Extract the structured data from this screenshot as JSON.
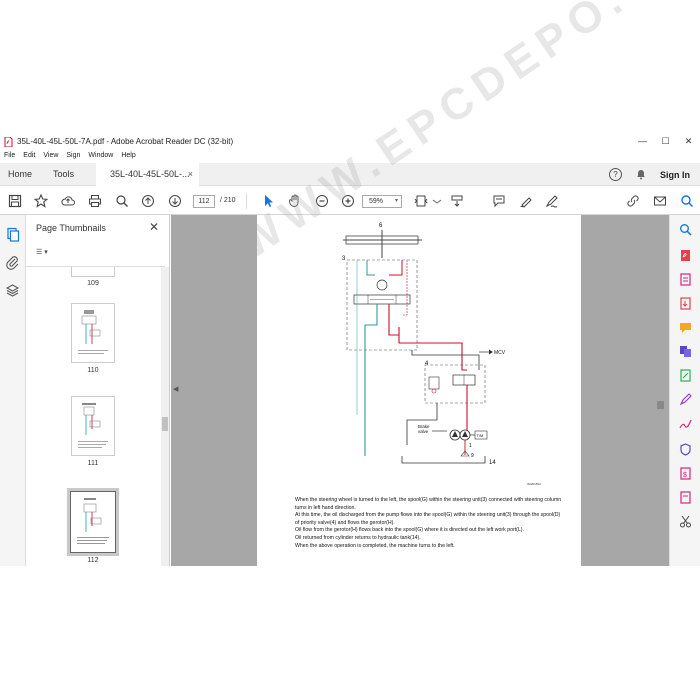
{
  "window": {
    "title": "35L-40L-45L-50L-7A.pdf - Adobe Acrobat Reader DC (32-bit)",
    "minimize": "—",
    "maximize": "☐",
    "close": "✕"
  },
  "menu": [
    "File",
    "Edit",
    "View",
    "Sign",
    "Window",
    "Help"
  ],
  "tabs": {
    "home": "Home",
    "tools": "Tools",
    "document": "35L-40L-45L-50L-...",
    "document_close": "×"
  },
  "header_right": {
    "help": "?",
    "signin": "Sign In"
  },
  "toolbar": {
    "page_current": "112",
    "page_total": "/ 210",
    "zoom": "59%"
  },
  "thumbnails": {
    "title": "Page Thumbnails",
    "close": "✕",
    "options": "☰ ▾",
    "pages": [
      {
        "label": "109"
      },
      {
        "label": "110"
      },
      {
        "label": "111"
      },
      {
        "label": "112",
        "selected": true
      }
    ]
  },
  "page": {
    "labels": {
      "n6": "6",
      "n3": "3",
      "n4": "4",
      "n1": "1",
      "n9": "9",
      "n14": "14",
      "mcv": "MCV",
      "brake": "Brake\nvalve",
      "tm": "T/M",
      "code": "3D201504"
    },
    "caption": [
      "When the steering wheel is turned to the left, the spool(G) within the steering unit(3) connected with steering column turns in left hand direction.",
      "At this time, the oil discharged from the pump flows into the spool(G) within the steering unit(3) through the spool(D) of priority valve(4) and flows the gerotor(H).",
      "Oil flow from the gerotor(H) flows back into the spool(G) where it is directed out the left work port(L).",
      "Oil returned from cylinder returns to hydraulic tank(14).",
      "When the above operation is completed, the machine turns to the left."
    ]
  },
  "watermark": "WWW.EPCDEPO.COM",
  "colors": {
    "accent_blue": "#1473e6",
    "line_red": "#c8102e",
    "line_teal": "#2a9d9d",
    "page_bg": "#a7a7a7"
  }
}
